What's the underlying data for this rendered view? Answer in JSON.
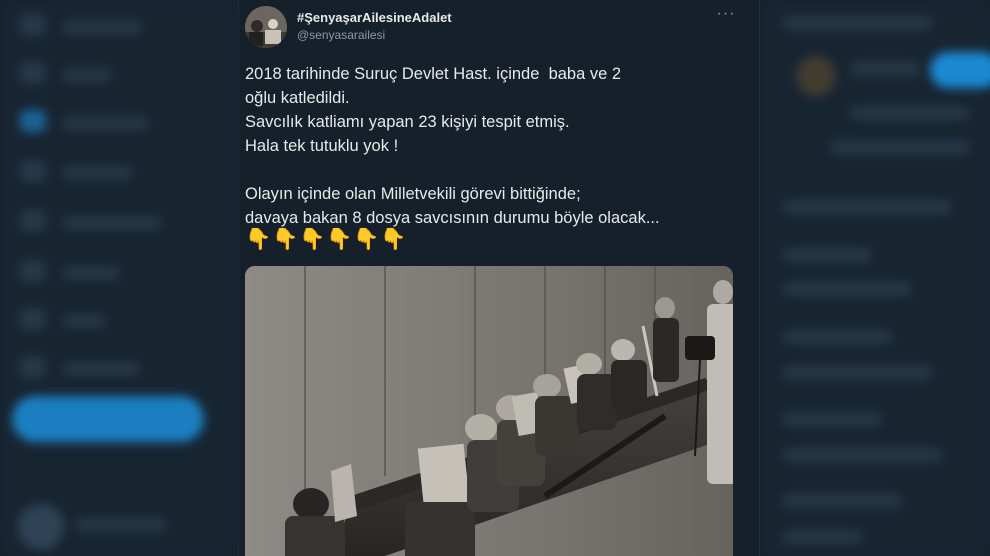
{
  "tweet": {
    "display_name": "#ŞenyaşarAilesineAdalet",
    "handle": "@senyasarailesi",
    "more_label": "···",
    "text_lines": [
      "2018 tarihinde Suruç Devlet Hast. içinde  baba ve 2",
      "oğlu katledildi.",
      "Savcılık katliamı yapan 23 kişiyi tespit etmiş.",
      "Hala tek tutuklu yok !",
      "",
      "Olayın içinde olan Milletvekili görevi bittiğinde;",
      "davaya bakan 8 dosya savcısının durumu böyle olacak..."
    ],
    "emojis": [
      "👇",
      "👇",
      "👇",
      "👇",
      "👇",
      "👇"
    ],
    "photo_icon": "black-and-white-courtroom-photo"
  },
  "colors": {
    "background": "#15202b",
    "text_primary": "#e7e9ea",
    "text_secondary": "#8b98a5",
    "accent": "#1d9bf0"
  }
}
